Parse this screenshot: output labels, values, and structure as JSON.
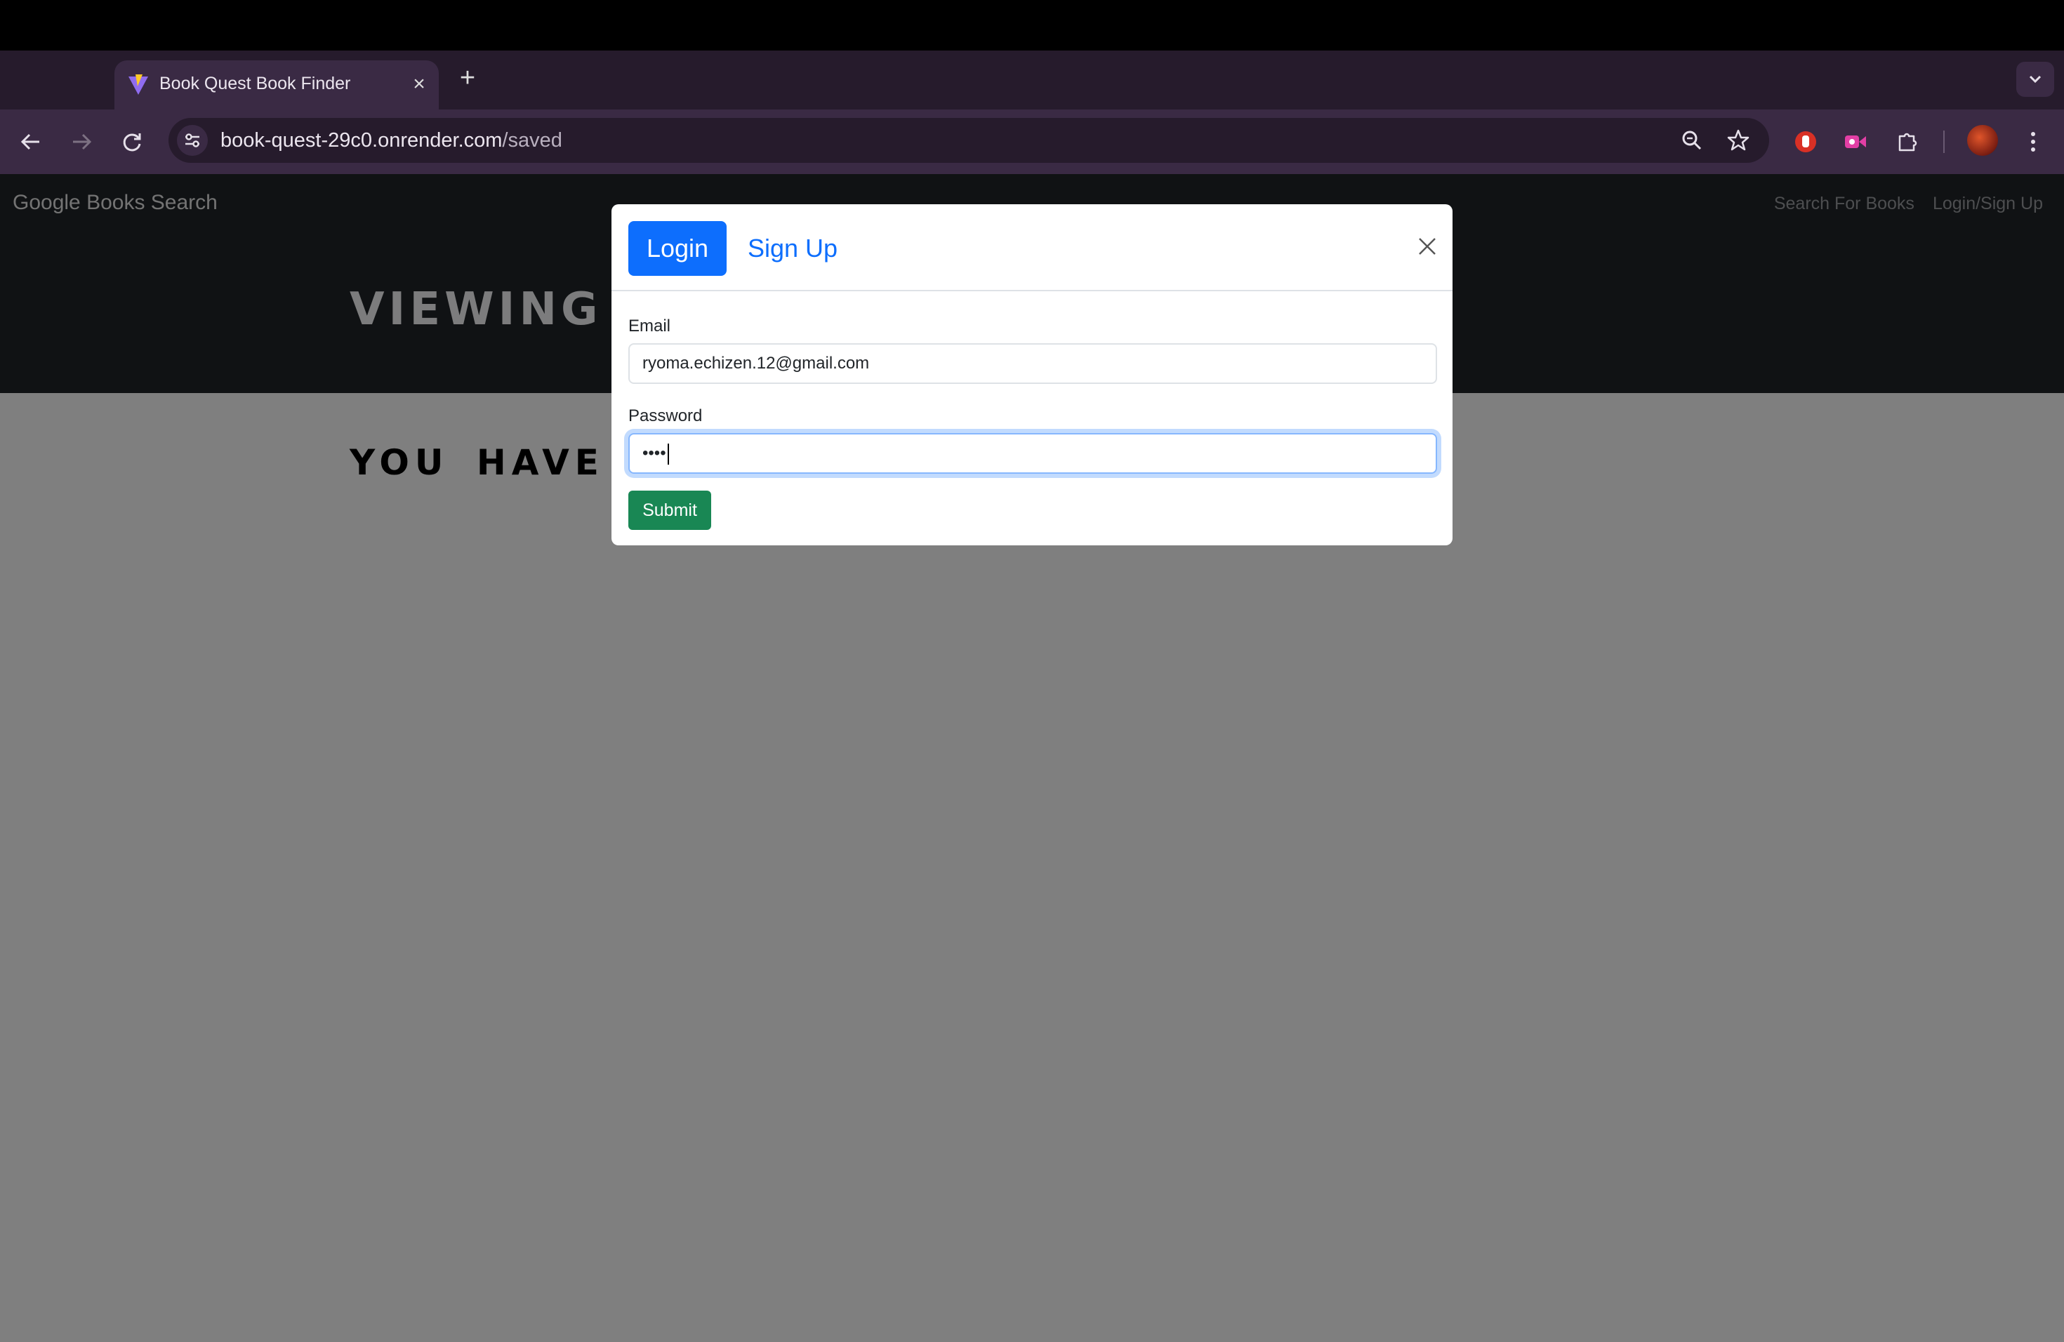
{
  "browser": {
    "tab": {
      "title": "Book Quest Book Finder"
    },
    "url": {
      "host": "book-quest-29c0.onrender.com",
      "path": "/saved"
    }
  },
  "navbar": {
    "brand": "Google Books Search",
    "links": [
      "Search For Books",
      "Login/Sign Up"
    ]
  },
  "hero": {
    "title": "VIEWING"
  },
  "content": {
    "title": "YOU HAVE"
  },
  "modal": {
    "tabs": {
      "login": "Login",
      "signup": "Sign Up"
    },
    "email": {
      "label": "Email",
      "value": "ryoma.echizen.12@gmail.com"
    },
    "password": {
      "label": "Password",
      "value": "••••"
    },
    "submit": "Submit"
  },
  "colors": {
    "primary": "#0d6efd",
    "success": "#198754",
    "navbar": "#212529",
    "browser_frame": "#3a2a44"
  },
  "icons": [
    "back-icon",
    "forward-icon",
    "reload-icon",
    "site-info-icon",
    "zoom-icon",
    "bookmark-star-icon",
    "extension-stop-icon",
    "extension-video-icon",
    "extensions-puzzle-icon",
    "more-menu-icon",
    "close-icon",
    "plus-icon",
    "chevron-down-icon"
  ]
}
